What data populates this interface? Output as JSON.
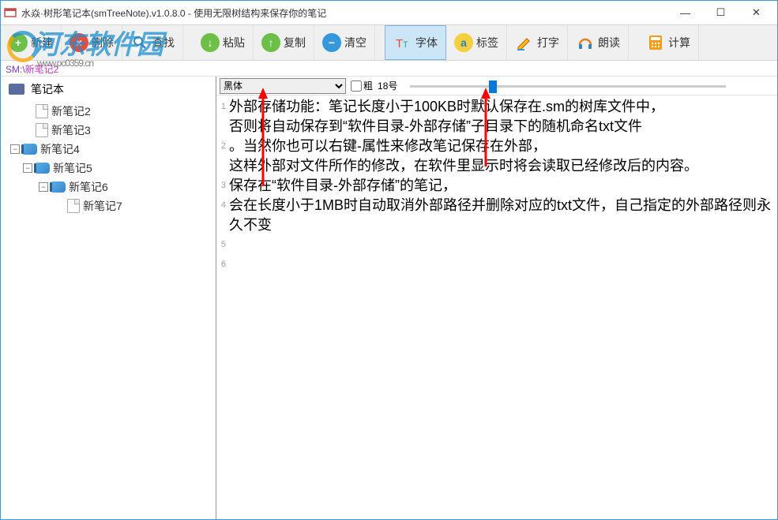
{
  "window": {
    "title": "水焱·树形笔记本(smTreeNote).v1.0.8.0 - 使用无限树结构来保存你的笔记"
  },
  "toolbar": {
    "new_label": "新建",
    "delete_label": "删除",
    "find_label": "查找",
    "paste_label": "粘贴",
    "copy_label": "复制",
    "clear_label": "清空",
    "font_label": "字体",
    "tag_label": "标签",
    "type_label": "打字",
    "read_label": "朗读",
    "calc_label": "计算"
  },
  "breadcrumb": {
    "root": "SM:\\",
    "path": "新笔记2"
  },
  "tree": {
    "header": "笔记本",
    "items": [
      {
        "label": "新笔记2"
      },
      {
        "label": "新笔记3"
      },
      {
        "label": "新笔记4"
      },
      {
        "label": "新笔记5"
      },
      {
        "label": "新笔记6"
      },
      {
        "label": "新笔记7"
      }
    ]
  },
  "editor": {
    "font_family": "黑体",
    "bold_label": "粗",
    "font_size_label": "18号",
    "lines": [
      "外部存储功能：笔记长度小于100KB时默认保存在.sm的树库文件中，",
      "否则将自动保存到“软件目录-外部存储”子目录下的随机命名txt文件",
      "。当然你也可以右键-属性来修改笔记保存在外部，",
      "这样外部对文件所作的修改，在软件里显示时将会读取已经修改后的内容。",
      "保存在“软件目录-外部存储”的笔记，",
      "会在长度小于1MB时自动取消外部路径并删除对应的txt文件，自己指定的外部路径则永久不变"
    ]
  },
  "watermark": {
    "text": "河东软件园",
    "sub": "www.pc0359.cn"
  }
}
